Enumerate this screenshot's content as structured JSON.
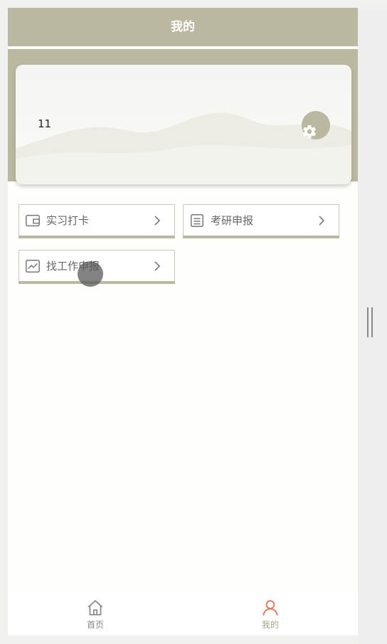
{
  "header": {
    "title": "我的"
  },
  "profile": {
    "username": "11"
  },
  "menu": [
    {
      "label": "实习打卡",
      "icon": "wallet-icon"
    },
    {
      "label": "考研申报",
      "icon": "form-icon"
    },
    {
      "label": "找工作申报",
      "icon": "chart-icon"
    }
  ],
  "tabbar": [
    {
      "label": "首页",
      "icon": "home-icon",
      "color": "#8a8a8a"
    },
    {
      "label": "我的",
      "icon": "user-icon",
      "color": "#e07a5f",
      "active": true
    }
  ],
  "colors": {
    "accent": "#bab89f",
    "active": "#e07a5f"
  }
}
